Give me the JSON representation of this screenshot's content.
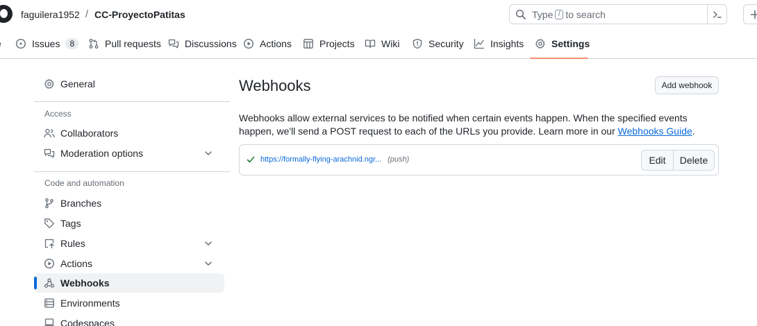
{
  "header": {
    "owner": "faguilera1952",
    "separator": "/",
    "repo": "CC-ProyectoPatitas",
    "search_prefix": "Type",
    "search_key": "/",
    "search_suffix": "to search"
  },
  "nav": {
    "issues": "Issues",
    "issues_count": "8",
    "pull_requests": "Pull requests",
    "discussions": "Discussions",
    "actions": "Actions",
    "projects": "Projects",
    "wiki": "Wiki",
    "security": "Security",
    "insights": "Insights",
    "settings": "Settings",
    "active_tab": "Settings"
  },
  "sidebar": {
    "general": "General",
    "access_heading": "Access",
    "collaborators": "Collaborators",
    "moderation": "Moderation options",
    "code_heading": "Code and automation",
    "branches": "Branches",
    "tags": "Tags",
    "rules": "Rules",
    "actions": "Actions",
    "webhooks": "Webhooks",
    "environments": "Environments",
    "codespaces": "Codespaces",
    "selected": "Webhooks"
  },
  "main": {
    "title": "Webhooks",
    "add_button": "Add webhook",
    "description": "Webhooks allow external services to be notified when certain events happen. When the specified events happen, we'll send a POST request to each of the URLs you provide. Learn more in our",
    "guide_link": "Webhooks Guide",
    "period": ".",
    "hook": {
      "url": "https://formally-flying-arachnid.ngr...",
      "event": "(push)",
      "status": "success",
      "edit": "Edit",
      "delete": "Delete"
    }
  },
  "colors": {
    "accent": "#0969da",
    "success": "#1a7f37",
    "underline": "#fd8c73",
    "border": "#d0d7de"
  }
}
